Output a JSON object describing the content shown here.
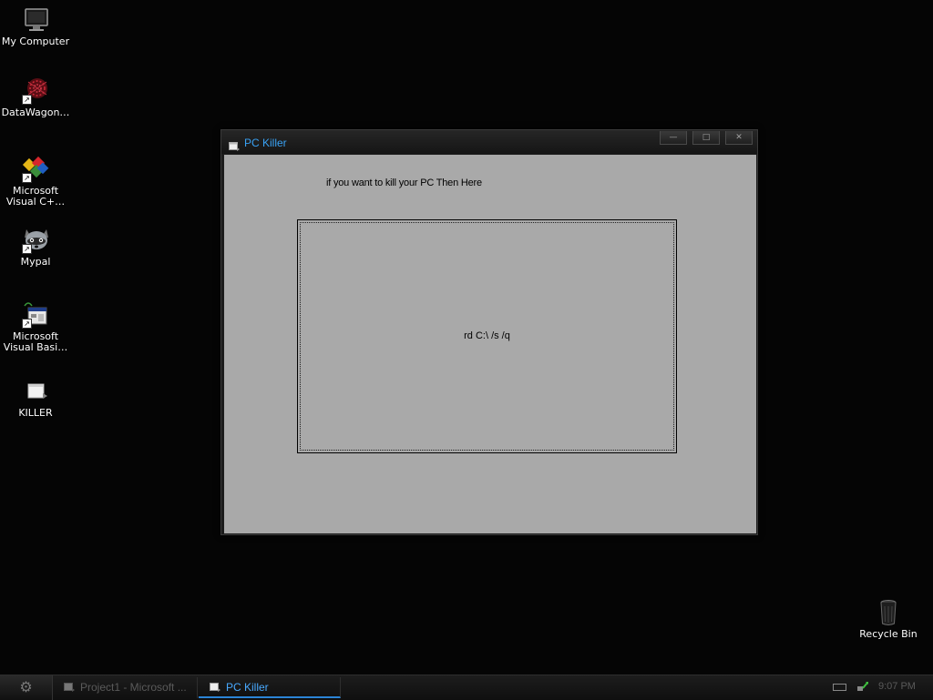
{
  "desktop": {
    "icons": [
      {
        "label": "My Computer",
        "icon": "monitor-icon"
      },
      {
        "label": "DataWagon…",
        "icon": "datawagon-icon"
      },
      {
        "label": "Microsoft Visual C+…",
        "icon": "visual-cpp-icon"
      },
      {
        "label": "Mypal",
        "icon": "raccoon-icon"
      },
      {
        "label": "Microsoft Visual Basi…",
        "icon": "visual-basic-icon"
      },
      {
        "label": "KILLER",
        "icon": "program-icon"
      },
      {
        "label": "Recycle Bin",
        "icon": "trash-icon"
      }
    ]
  },
  "window": {
    "title": "PC Killer",
    "controls": [
      "minimize",
      "maximize",
      "close"
    ],
    "prompt_text": "if you want to kill your PC Then Here",
    "button_text": "rd C:\\ /s /q"
  },
  "taskbar": {
    "start_icon": "start-orb-icon",
    "tasks": [
      {
        "label": "Project1 - Microsoft ...",
        "active": false
      },
      {
        "label": "PC Killer",
        "active": true
      }
    ],
    "clock": "9:07 PM"
  },
  "colors": {
    "desktop_bg": "#050505",
    "title_text": "#39a2f5",
    "client_bg": "#a9a9a9",
    "active_task": "#48a9ff"
  }
}
